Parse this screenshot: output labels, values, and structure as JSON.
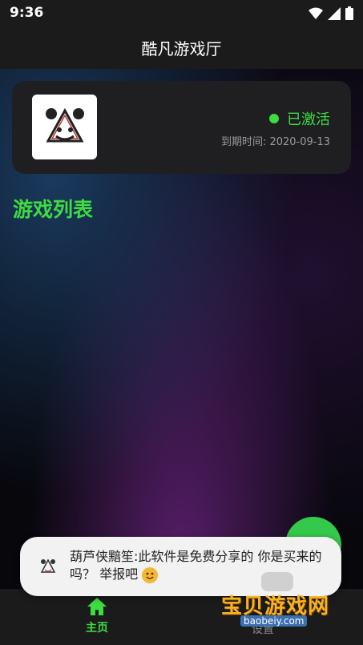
{
  "status_bar": {
    "time": "9:36",
    "icons": [
      "wifi-icon",
      "signal-icon",
      "battery-icon"
    ]
  },
  "app_bar": {
    "title": "酷凡游戏厅"
  },
  "license_card": {
    "status": "已激活",
    "expiry": "到期时间: 2020-09-13",
    "status_color": "#3ddc40"
  },
  "section": {
    "title": "游戏列表"
  },
  "bottom_nav": {
    "home_label": "主页",
    "settings_label": "设置",
    "active_color": "#3ddc40"
  },
  "toast": {
    "message": "葫芦侠黯笙:此软件是免费分享的 你是买来的吗？ 举报吧"
  },
  "watermark": {
    "text_cn": "宝贝游戏网",
    "text_en": "baobeiy.com"
  }
}
